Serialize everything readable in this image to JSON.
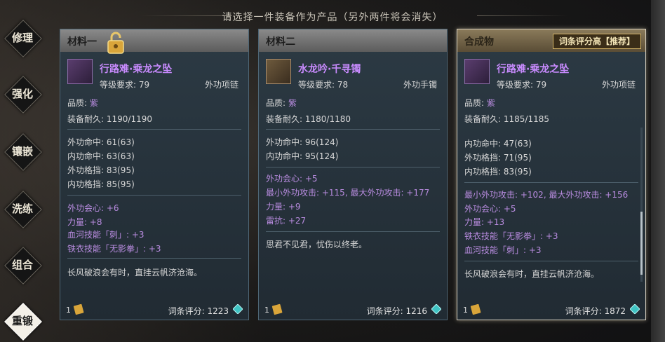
{
  "header": {
    "title": "请选择一件装备作为产品（另外两件将会消失）"
  },
  "sidebar": {
    "items": [
      {
        "label": "修理",
        "active": false
      },
      {
        "label": "强化",
        "active": false
      },
      {
        "label": "镶嵌",
        "active": false
      },
      {
        "label": "洗练",
        "active": false
      },
      {
        "label": "组合",
        "active": false
      },
      {
        "label": "重锻",
        "active": true
      }
    ]
  },
  "panels": [
    {
      "title": "材料一",
      "has_lock": true,
      "item_name": "行路难·乘龙之坠",
      "level_req": "等级要求: 79",
      "item_type": "外功项链",
      "quality_label": "品质:",
      "quality_value": "紫",
      "durability": "装备耐久: 1190/1190",
      "base_stats": [
        "外功命中: 61(63)",
        "内功命中: 63(63)",
        "外功格挡: 83(95)",
        "内功格挡: 85(95)"
      ],
      "extra_stats": [
        "外功会心: +6",
        "力量: +8",
        "血河技能「刺」: +3",
        "铁衣技能「无影拳」: +3"
      ],
      "description": "长风破浪会有时，直挂云帆济沧海。",
      "count": "1",
      "score_label": "词条评分: 1223"
    },
    {
      "title": "材料二",
      "has_lock": false,
      "item_name": "水龙吟·千寻镯",
      "level_req": "等级要求: 78",
      "item_type": "外功手镯",
      "quality_label": "品质:",
      "quality_value": "紫",
      "durability": "装备耐久: 1180/1180",
      "base_stats": [
        "外功命中: 96(124)",
        "内功命中: 95(124)"
      ],
      "extra_stats": [
        "外功会心: +5",
        "最小外功攻击: +115, 最大外功攻击: +177",
        "力量: +9",
        "雷抗: +27"
      ],
      "description": "思君不见君，忧伤以终老。",
      "count": "1",
      "score_label": "词条评分: 1216"
    },
    {
      "title": "合成物",
      "has_lock": false,
      "recommend": "词条评分高【推荐】",
      "item_name": "行路难·乘龙之坠",
      "level_req": "等级要求: 79",
      "item_type": "外功项链",
      "quality_label": "品质:",
      "quality_value": "紫",
      "durability": "装备耐久: 1185/1185",
      "base_stats": [
        "内功命中: 47(63)",
        "外功格挡: 71(95)",
        "内功格挡: 83(95)"
      ],
      "extra_stats": [
        "最小外功攻击: +102, 最大外功攻击: +156",
        "外功会心: +5",
        "力量: +13",
        "铁衣技能「无影拳」: +3",
        "血河技能「刺」: +3"
      ],
      "description": "长风破浪会有时，直挂云帆济沧海。",
      "count": "1",
      "score_label": "词条评分: 1872"
    }
  ]
}
